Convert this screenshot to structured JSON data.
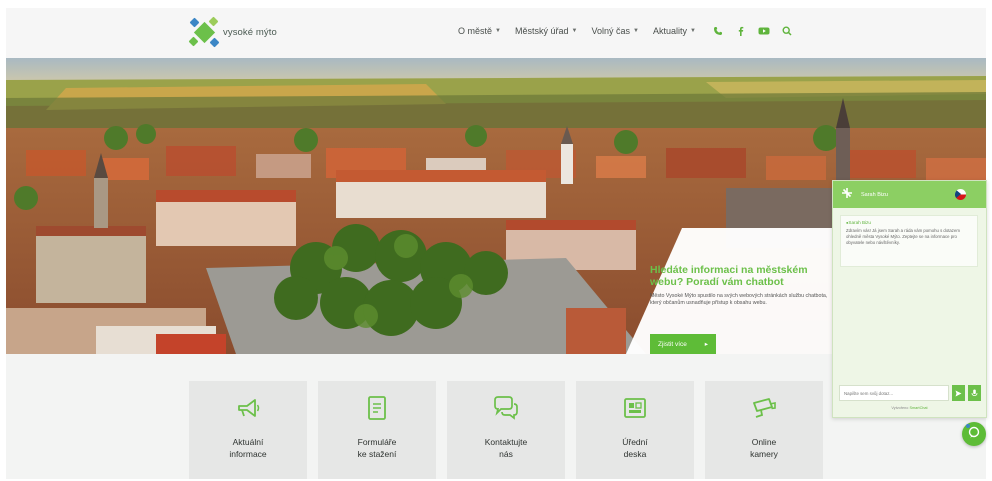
{
  "site": {
    "logo_text": "vysoké mýto"
  },
  "nav": {
    "items": [
      {
        "label": "O městě"
      },
      {
        "label": "Městský úřad"
      },
      {
        "label": "Volný čas"
      },
      {
        "label": "Aktuality"
      }
    ],
    "icons": [
      "phone-icon",
      "facebook-icon",
      "youtube-icon",
      "search-icon"
    ]
  },
  "hero": {
    "title": "Hledáte informaci na městském webu? Poradí vám chatbot",
    "description": "Město Vysoké Mýto spustilo na svých webových stránkách službu chatbota, který občanům usnadňuje přístup k obsahu webu.",
    "button_label": "Zjistit více"
  },
  "tiles": [
    {
      "label": "Aktuální\ninformace",
      "icon": "megaphone-icon"
    },
    {
      "label": "Formuláře\nke stažení",
      "icon": "document-icon"
    },
    {
      "label": "Kontaktujte\nnás",
      "icon": "chat-bubbles-icon"
    },
    {
      "label": "Úřední\ndeska",
      "icon": "notice-board-icon"
    },
    {
      "label": "Online\nkamery",
      "icon": "camera-icon"
    }
  ],
  "chat": {
    "title": "Sarah Bizu",
    "sender": "Sarah Bizu",
    "message": "Zdravím vás! Já jsem Sarah a ráda vám pomohu s dotazem ohledně města Vysoké Mýto. Zeptejte se na informace pro obyvatele nebo návštěvníky.",
    "input_placeholder": "Napište sem svůj dotaz...",
    "footer_text": "Vytvořeno",
    "footer_brand": "SmartChat"
  },
  "colors": {
    "brand_green": "#5ebc37",
    "brand_blue": "#3b86c5"
  }
}
